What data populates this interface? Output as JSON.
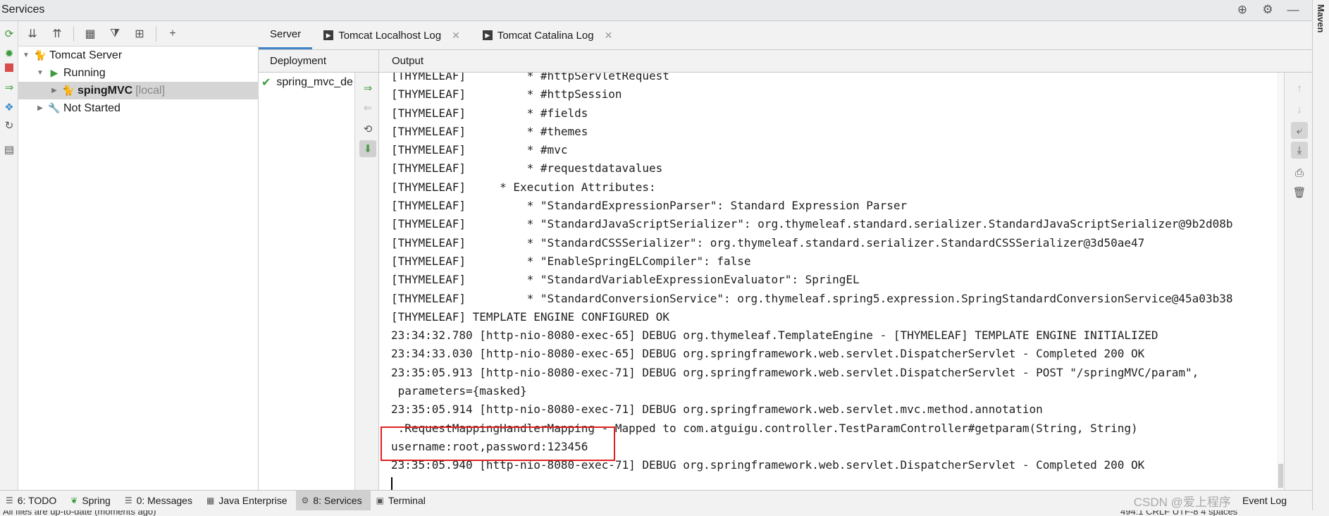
{
  "window": {
    "title": "Services"
  },
  "right_strip": {
    "label": "Maven"
  },
  "tree": {
    "rows": [
      {
        "label": "Tomcat Server",
        "suffix": ""
      },
      {
        "label": "Running",
        "suffix": ""
      },
      {
        "label": "spingMVC",
        "suffix": "[local]"
      },
      {
        "label": "Not Started",
        "suffix": ""
      }
    ]
  },
  "tabs": [
    {
      "label": "Server"
    },
    {
      "label": "Tomcat Localhost Log"
    },
    {
      "label": "Tomcat Catalina Log"
    }
  ],
  "deployment": {
    "header": "Deployment",
    "item": "spring_mvc_demo"
  },
  "output": {
    "header": "Output",
    "lines": [
      "[THYMELEAF]         * #httpServletRequest",
      "[THYMELEAF]         * #httpSession",
      "[THYMELEAF]         * #fields",
      "[THYMELEAF]         * #themes",
      "[THYMELEAF]         * #mvc",
      "[THYMELEAF]         * #requestdatavalues",
      "[THYMELEAF]     * Execution Attributes:",
      "[THYMELEAF]         * \"StandardExpressionParser\": Standard Expression Parser",
      "[THYMELEAF]         * \"StandardJavaScriptSerializer\": org.thymeleaf.standard.serializer.StandardJavaScriptSerializer@9b2d08b",
      "[THYMELEAF]         * \"StandardCSSSerializer\": org.thymeleaf.standard.serializer.StandardCSSSerializer@3d50ae47",
      "[THYMELEAF]         * \"EnableSpringELCompiler\": false",
      "[THYMELEAF]         * \"StandardVariableExpressionEvaluator\": SpringEL",
      "[THYMELEAF]         * \"StandardConversionService\": org.thymeleaf.spring5.expression.SpringStandardConversionService@45a03b38",
      "[THYMELEAF] TEMPLATE ENGINE CONFIGURED OK",
      "23:34:32.780 [http-nio-8080-exec-65] DEBUG org.thymeleaf.TemplateEngine - [THYMELEAF] TEMPLATE ENGINE INITIALIZED",
      "23:34:33.030 [http-nio-8080-exec-65] DEBUG org.springframework.web.servlet.DispatcherServlet - Completed 200 OK",
      "23:35:05.913 [http-nio-8080-exec-71] DEBUG org.springframework.web.servlet.DispatcherServlet - POST \"/springMVC/param\",",
      " parameters={masked}",
      "23:35:05.914 [http-nio-8080-exec-71] DEBUG org.springframework.web.servlet.mvc.method.annotation",
      " .RequestMappingHandlerMapping - Mapped to com.atguigu.controller.TestParamController#getparam(String, String)",
      "username:root,password:123456",
      "23:35:05.940 [http-nio-8080-exec-71] DEBUG org.springframework.web.servlet.DispatcherServlet - Completed 200 OK"
    ]
  },
  "bottom_bar": {
    "items": [
      {
        "label": "6: TODO",
        "icon": "list-icon"
      },
      {
        "label": "Spring",
        "icon": "spring-leaf-icon"
      },
      {
        "label": "0: Messages",
        "icon": "messages-icon"
      },
      {
        "label": "Java Enterprise",
        "icon": "java-enterprise-icon"
      },
      {
        "label": "8: Services",
        "icon": "services-icon"
      },
      {
        "label": "Terminal",
        "icon": "terminal-icon"
      }
    ],
    "watermark": "CSDN @爱上程序",
    "event_log": "Event Log"
  },
  "status_bar": {
    "left": "All files are up-to-date (moments ago)",
    "right": "494:1   CRLF   UTF-8   4 spaces"
  },
  "colors": {
    "accent": "#4083c9",
    "highlight_box": "#e02020",
    "run_green": "#3c9b3c"
  }
}
